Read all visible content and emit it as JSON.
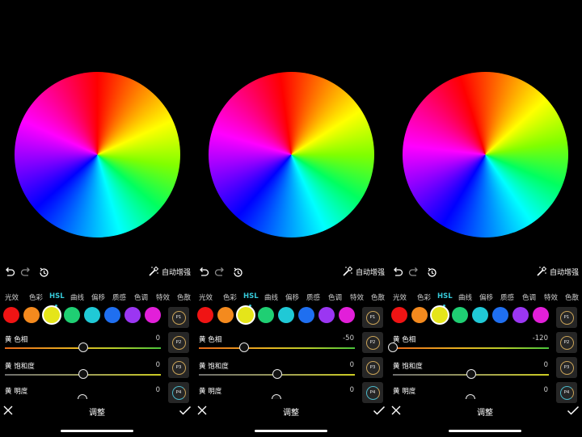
{
  "toolbar": {
    "auto_enhance_label": "自动增强"
  },
  "tabs": [
    "光效",
    "色彩",
    "HSL",
    "曲线",
    "偏移",
    "质感",
    "色调",
    "特效",
    "色散"
  ],
  "swatch_colors": [
    "#f01414",
    "#f48a1e",
    "#e5e51a",
    "#1fcf73",
    "#20c9d6",
    "#1f6ff0",
    "#9b36f2",
    "#e21fd9"
  ],
  "presets": [
    "P1",
    "P2",
    "P3",
    "P4"
  ],
  "slider_labels": {
    "hue": "黄 色相",
    "saturation": "黄 饱和度",
    "brightness": "黄 明度"
  },
  "bottom_bar": {
    "title": "调整"
  },
  "panels": [
    {
      "hue_value": "0",
      "saturation_value": "0",
      "brightness_value": "0",
      "hue_fraction": 0.5,
      "saturation_fraction": 0.5,
      "rotate_deg": 0
    },
    {
      "hue_value": "-50",
      "saturation_value": "0",
      "brightness_value": "0",
      "hue_fraction": 0.29,
      "saturation_fraction": 0.5,
      "rotate_deg": -8
    },
    {
      "hue_value": "-120",
      "saturation_value": "0",
      "brightness_value": "0",
      "hue_fraction": 0.0,
      "saturation_fraction": 0.5,
      "rotate_deg": -18
    }
  ]
}
